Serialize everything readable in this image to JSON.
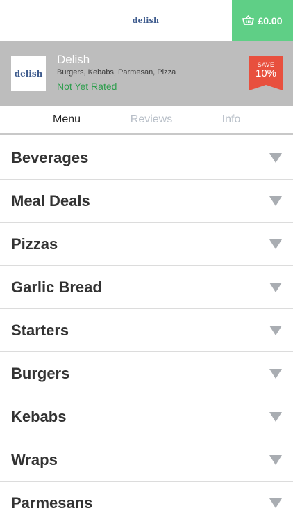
{
  "header": {
    "logo_text": "delish",
    "basket_total": "£0.00"
  },
  "restaurant": {
    "logo_text": "delish",
    "name": "Delish",
    "cuisines": "Burgers, Kebabs, Parmesan, Pizza",
    "rating": "Not Yet Rated",
    "badge_label": "SAVE",
    "badge_value": "10%"
  },
  "tabs": [
    {
      "label": "Menu",
      "active": true
    },
    {
      "label": "Reviews",
      "active": false
    },
    {
      "label": "Info",
      "active": false
    }
  ],
  "menu": {
    "categories": [
      {
        "label": "Beverages"
      },
      {
        "label": "Meal Deals"
      },
      {
        "label": "Pizzas"
      },
      {
        "label": "Garlic Bread"
      },
      {
        "label": "Starters"
      },
      {
        "label": "Burgers"
      },
      {
        "label": "Kebabs"
      },
      {
        "label": "Wraps"
      },
      {
        "label": "Parmesans"
      }
    ]
  },
  "colors": {
    "basket_green": "#5fcf86",
    "rating_green": "#2e9e4e",
    "badge_red": "#e8503e",
    "header_grey": "#bdbdbd"
  }
}
